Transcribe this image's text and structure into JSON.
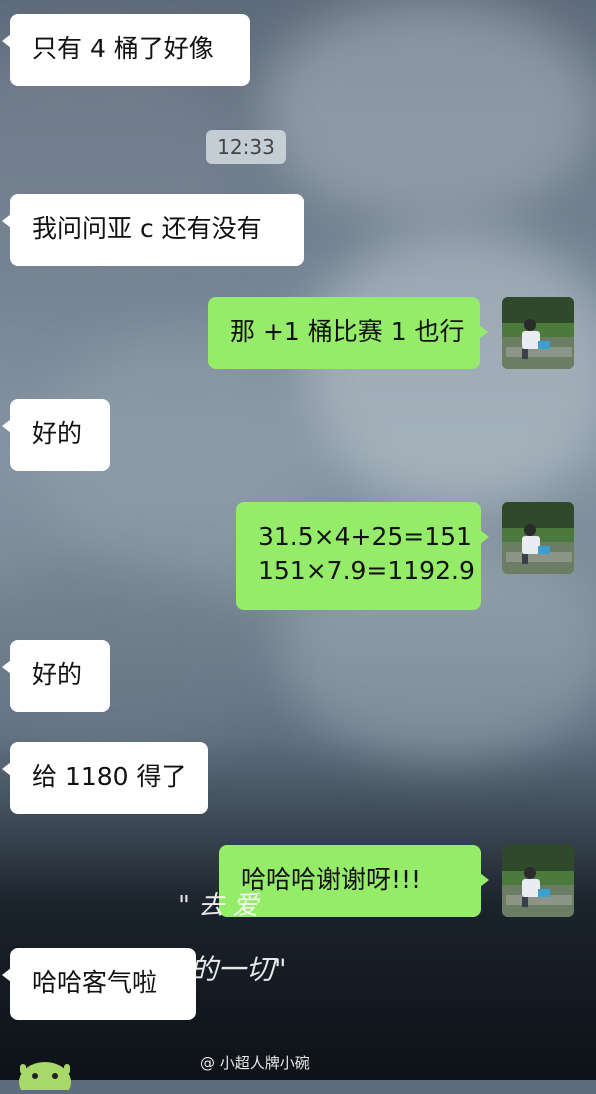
{
  "chat": {
    "timestamp": "12:33",
    "messages": [
      {
        "side": "in",
        "text": "只有 4 桶了好像"
      },
      {
        "side": "in",
        "text": "我问问亚 c 还有没有"
      },
      {
        "side": "out",
        "text": "那 +1 桶比赛 1 也行"
      },
      {
        "side": "in",
        "text": "好的"
      },
      {
        "side": "out",
        "lines": [
          "31.5×4+25=151",
          "151×7.9=1192.9"
        ]
      },
      {
        "side": "in",
        "text": "好的"
      },
      {
        "side": "in",
        "text": "给 1180 得了"
      },
      {
        "side": "out",
        "text": "哈哈哈谢谢呀!!!"
      },
      {
        "side": "in",
        "text": "哈哈客气啦"
      }
    ]
  },
  "overlay": {
    "handwriting_line1": "\" 去 爱",
    "handwriting_line2": "\"  去拥有的一切\"",
    "watermark": "@ 小超人牌小碗"
  },
  "colors": {
    "incoming_bubble": "#ffffff",
    "outgoing_bubble": "#95ec69"
  },
  "icons": [
    "user-avatar",
    "weibo-icon",
    "android-sticker-icon"
  ]
}
